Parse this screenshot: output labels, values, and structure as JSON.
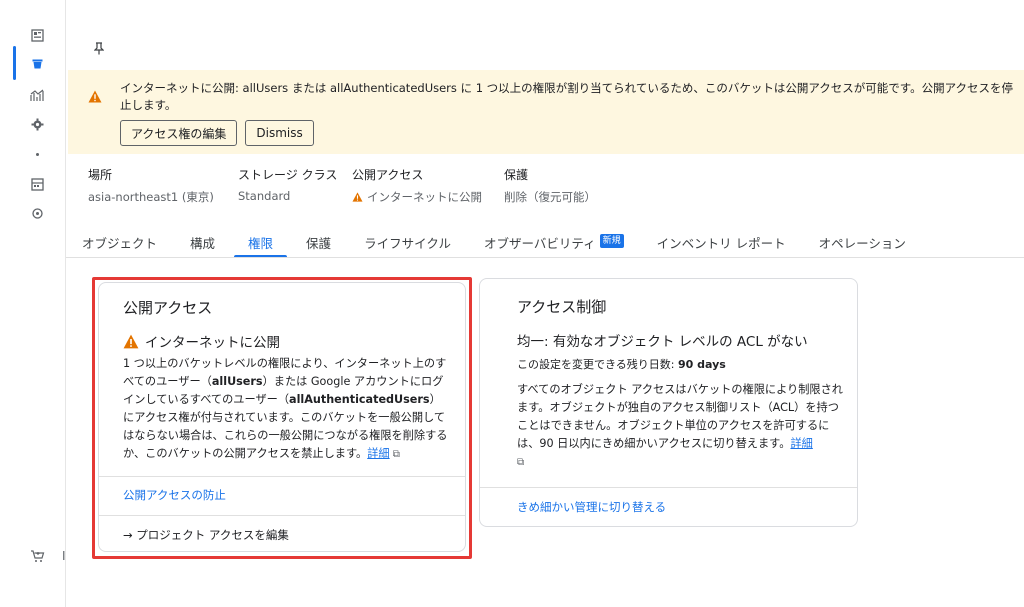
{
  "pin_icon": "pin-icon",
  "banner": {
    "message": "インターネットに公開: allUsers または allAuthenticatedUsers に 1 つ以上の権限が割り当てられているため、このバケットは公開アクセスが可能です。公開アクセスを停止します。",
    "edit_access_label": "アクセス権の編集",
    "dismiss_label": "Dismiss",
    "bg_color": "#fef7e0",
    "icon": "warning-icon"
  },
  "meta": {
    "location_label": "場所",
    "location_value": "asia-northeast1 (東京)",
    "storage_class_label": "ストレージ クラス",
    "storage_class_value": "Standard",
    "public_access_label": "公開アクセス",
    "public_access_value": "インターネットに公開",
    "protection_label": "保護",
    "protection_value": "削除（復元可能）"
  },
  "tabs": [
    {
      "label": "オブジェクト"
    },
    {
      "label": "構成"
    },
    {
      "label": "権限",
      "active": true
    },
    {
      "label": "保護"
    },
    {
      "label": "ライフサイクル"
    },
    {
      "label": "オブザーバビリティ",
      "badge": "新規"
    },
    {
      "label": "インベントリ レポート"
    },
    {
      "label": "オペレーション"
    }
  ],
  "public_access_card": {
    "title": "公開アクセス",
    "status": "インターネットに公開",
    "body_1": "1 つ以上のバケットレベルの権限により、インターネット上のすべてのユーザー（",
    "body_bold_1": "allUsers",
    "body_2": "）または Google アカウントにログインしているすべてのユーザー（",
    "body_bold_2": "allAuthenticatedUsers",
    "body_3": "）にアクセス権が付与されています。このバケットを一般公開してはならない場合は、これらの一般公開につながる権限を削除するか、このバケットの公開アクセスを禁止します。",
    "details_link": "詳細",
    "prevent_action": "公開アクセスの防止",
    "edit_project_action": "プロジェクト アクセスを編集",
    "highlight_color": "#e53935"
  },
  "access_control_card": {
    "title": "アクセス制御",
    "subtitle": "均一: 有効なオブジェクト レベルの ACL がない",
    "remaining_label": "この設定を変更できる残り日数:",
    "remaining_value": "90 days",
    "body": "すべてのオブジェクト アクセスはバケットの権限により制限されます。オブジェクトが独自のアクセス制御リスト（ACL）を持つことはできません。オブジェクト単位のアクセスを許可するには、90 日以内にきめ細かいアクセスに切り替えます。",
    "details_link": "詳細",
    "switch_action": "きめ細かい管理に切り替える"
  },
  "rail": {
    "truncated_text": "I"
  },
  "colors": {
    "accent": "#1a73e8",
    "warning": "#e37400"
  }
}
